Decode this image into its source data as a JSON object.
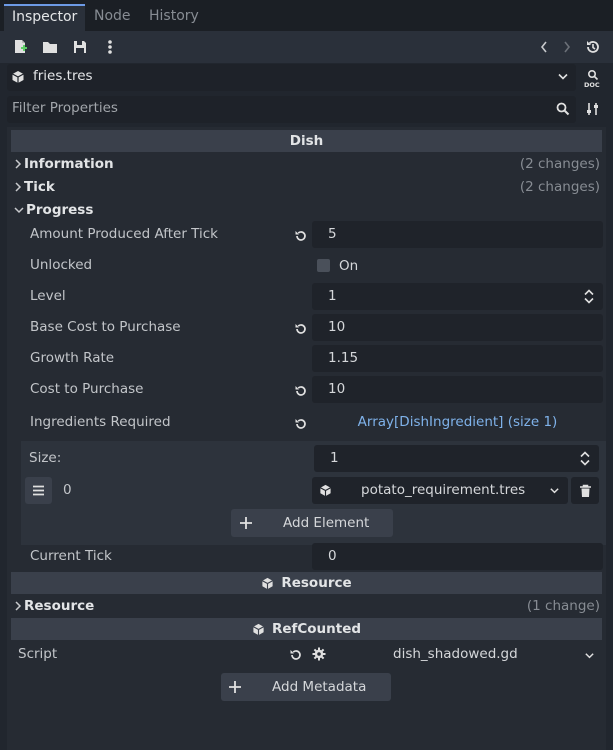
{
  "tabs": [
    {
      "label": "Inspector",
      "active": true
    },
    {
      "label": "Node",
      "active": false
    },
    {
      "label": "History",
      "active": false
    }
  ],
  "resource": {
    "name": "fries.tres"
  },
  "filter": {
    "placeholder": "Filter Properties"
  },
  "categories": {
    "dish": "Dish",
    "resource": "Resource",
    "refcounted": "RefCounted"
  },
  "sections": {
    "information": {
      "label": "Information",
      "changes": "(2 changes)"
    },
    "tick": {
      "label": "Tick",
      "changes": "(2 changes)"
    },
    "progress": {
      "label": "Progress"
    },
    "resource": {
      "label": "Resource",
      "changes": "(1 change)"
    }
  },
  "properties": {
    "amount_produced": {
      "label": "Amount Produced After Tick",
      "value": "5"
    },
    "unlocked": {
      "label": "Unlocked",
      "value": "On",
      "checked": false
    },
    "level": {
      "label": "Level",
      "value": "1"
    },
    "base_cost": {
      "label": "Base Cost to Purchase",
      "value": "10"
    },
    "growth_rate": {
      "label": "Growth Rate",
      "value": "1.15"
    },
    "cost_to_purchase": {
      "label": "Cost to Purchase",
      "value": "10"
    },
    "ingredients": {
      "label": "Ingredients Required",
      "value": "Array[DishIngredient] (size 1)"
    },
    "current_tick": {
      "label": "Current Tick",
      "value": "0"
    },
    "script": {
      "label": "Script",
      "value": "dish_shadowed.gd"
    }
  },
  "array": {
    "size_label": "Size:",
    "size_value": "1",
    "element_index": "0",
    "element_value": "potato_requirement.tres",
    "add_element": "Add Element"
  },
  "add_metadata": "Add Metadata",
  "colors": {
    "accent": "#6d9ae6",
    "link": "#7fb2ea",
    "background": "#21262e"
  }
}
